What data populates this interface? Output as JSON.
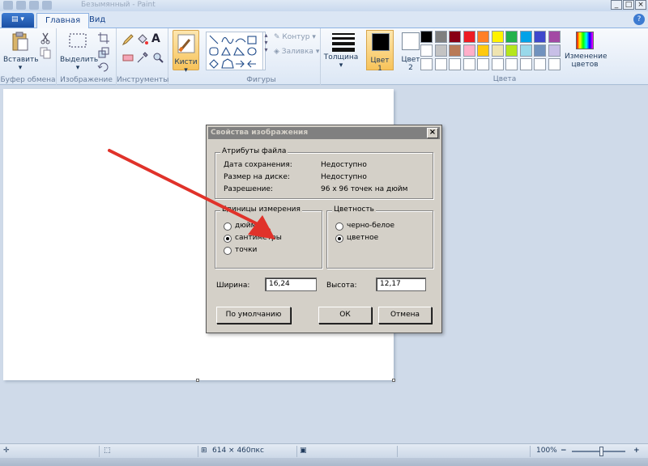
{
  "window": {
    "title": "Безымянный - Paint",
    "minimize": "_",
    "maximize": "□",
    "close": "×"
  },
  "tabs": {
    "file": "▤ ▾",
    "home": "Главная",
    "view": "Вид",
    "help": "?"
  },
  "ribbon": {
    "clipboard": {
      "paste": "Вставить",
      "paste_arrow": "▾",
      "group": "Буфер обмена"
    },
    "image": {
      "select": "Выделить",
      "select_arrow": "▾",
      "group": "Изображение"
    },
    "tools": {
      "group": "Инструменты"
    },
    "brushes": {
      "label": "Кисти",
      "arrow": "▾"
    },
    "shapes": {
      "outline": "Контур",
      "fill": "Заливка",
      "group": "Фигуры"
    },
    "size": {
      "label": "Толщина",
      "arrow": "▾"
    },
    "colors": {
      "color1_label": "Цвет",
      "color1_num": "1",
      "color2_label": "Цвет",
      "color2_num": "2",
      "edit": "Изменение цветов",
      "group": "Цвета",
      "color1": "#000000",
      "color2": "#ffffff",
      "palette": [
        "#000000",
        "#7f7f7f",
        "#880015",
        "#ed1c24",
        "#ff7f27",
        "#fff200",
        "#22b14c",
        "#00a2e8",
        "#3f48cc",
        "#a349a4",
        "#ffffff",
        "#c3c3c3",
        "#b97a57",
        "#ffaec9",
        "#ffc90e",
        "#efe4b0",
        "#b5e61d",
        "#99d9ea",
        "#7092be",
        "#c8bfe7",
        "#ffffff",
        "#ffffff",
        "#ffffff",
        "#ffffff",
        "#ffffff",
        "#ffffff",
        "#ffffff",
        "#ffffff",
        "#ffffff",
        "#ffffff"
      ]
    }
  },
  "dialog": {
    "title": "Свойства изображения",
    "close": "×",
    "file_attrs": {
      "legend": "Атрибуты файла",
      "saved_label": "Дата сохранения:",
      "saved_value": "Недоступно",
      "size_label": "Размер на диске:",
      "size_value": "Недоступно",
      "res_label": "Разрешение:",
      "res_value": "96 x 96 точек на дюйм"
    },
    "units": {
      "legend": "Единицы измерения",
      "options": [
        "дюймы",
        "сантиметры",
        "точки"
      ],
      "selected": "сантиметры"
    },
    "color": {
      "legend": "Цветность",
      "options": [
        "черно-белое",
        "цветное"
      ],
      "selected": "цветное"
    },
    "width_label": "Ширина:",
    "width_value": "16,24",
    "height_label": "Высота:",
    "height_value": "12,17",
    "default_btn": "По умолчанию",
    "ok_btn": "ОК",
    "cancel_btn": "Отмена"
  },
  "status": {
    "cursor_icon": "✛",
    "selection_icon": "⬚",
    "size": "614 × 460пкс",
    "disk_icon": "▣",
    "zoom": "100%",
    "zoom_minus": "−",
    "zoom_plus": "+"
  },
  "annotation_color": "#e0322a"
}
